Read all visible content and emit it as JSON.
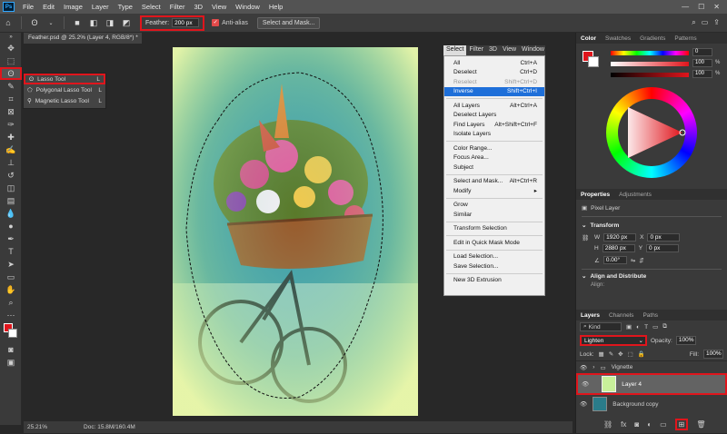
{
  "menubar": {
    "logo": "Ps",
    "items": [
      "File",
      "Edit",
      "Image",
      "Layer",
      "Type",
      "Select",
      "Filter",
      "3D",
      "View",
      "Window",
      "Help"
    ]
  },
  "options": {
    "feather_label": "Feather:",
    "feather_value": "200 px",
    "antialias_label": "Anti-alias",
    "select_mask_label": "Select and Mask..."
  },
  "document": {
    "tab_title": "Feather.psd @ 25.2% (Layer 4, RGB/8*) *",
    "zoom": "25.21%",
    "doc_size": "Doc: 15.8M/160.4M"
  },
  "flyout": {
    "items": [
      {
        "label": "Lasso Tool",
        "key": "L"
      },
      {
        "label": "Polygonal Lasso Tool",
        "key": "L"
      },
      {
        "label": "Magnetic Lasso Tool",
        "key": "L"
      }
    ]
  },
  "select_menu": {
    "bar": [
      "Select",
      "Filter",
      "3D",
      "View",
      "Window"
    ],
    "items": [
      {
        "label": "All",
        "key": "Ctrl+A"
      },
      {
        "label": "Deselect",
        "key": "Ctrl+D"
      },
      {
        "label": "Reselect",
        "key": "Shift+Ctrl+D",
        "disabled": true
      },
      {
        "label": "Inverse",
        "key": "Shift+Ctrl+I",
        "highlight": true
      },
      {
        "sep": true
      },
      {
        "label": "All Layers",
        "key": "Alt+Ctrl+A"
      },
      {
        "label": "Deselect Layers",
        "key": ""
      },
      {
        "label": "Find Layers",
        "key": "Alt+Shift+Ctrl+F"
      },
      {
        "label": "Isolate Layers",
        "key": ""
      },
      {
        "sep": true
      },
      {
        "label": "Color Range...",
        "key": ""
      },
      {
        "label": "Focus Area...",
        "key": ""
      },
      {
        "label": "Subject",
        "key": ""
      },
      {
        "sep": true
      },
      {
        "label": "Select and Mask...",
        "key": "Alt+Ctrl+R"
      },
      {
        "label": "Modify",
        "key": "▸"
      },
      {
        "sep": true
      },
      {
        "label": "Grow",
        "key": ""
      },
      {
        "label": "Similar",
        "key": ""
      },
      {
        "sep": true
      },
      {
        "label": "Transform Selection",
        "key": ""
      },
      {
        "sep": true
      },
      {
        "label": "Edit in Quick Mask Mode",
        "key": ""
      },
      {
        "sep": true
      },
      {
        "label": "Load Selection...",
        "key": ""
      },
      {
        "label": "Save Selection...",
        "key": ""
      },
      {
        "sep": true
      },
      {
        "label": "New 3D Extrusion",
        "key": ""
      }
    ]
  },
  "color_panel": {
    "tabs": [
      "Color",
      "Swatches",
      "Gradients",
      "Patterns"
    ],
    "values": [
      "0",
      "100",
      "100"
    ],
    "percent": "%",
    "fg_color": "#e0151c"
  },
  "properties": {
    "tabs": [
      "Properties",
      "Adjustments"
    ],
    "kind": "Pixel Layer",
    "transform_label": "Transform",
    "w": "1920 px",
    "h": "2880 px",
    "x": "0 px",
    "y": "0 px",
    "angle": "0.00°",
    "align_label": "Align and Distribute",
    "align_sub": "Align:"
  },
  "layers_panel": {
    "tabs": [
      "Layers",
      "Channels",
      "Paths"
    ],
    "kind_label": "Kind",
    "blend_mode": "Lighten",
    "opacity_label": "Opacity:",
    "opacity": "100%",
    "lock_label": "Lock:",
    "fill_label": "Fill:",
    "fill": "100%",
    "layers": [
      {
        "name": "Vignette",
        "group": true
      },
      {
        "name": "Layer 4",
        "selected": true
      },
      {
        "name": "Background copy"
      }
    ]
  },
  "colors": {
    "accent_red": "#e0151c",
    "highlight_blue": "#1e6fd9"
  }
}
